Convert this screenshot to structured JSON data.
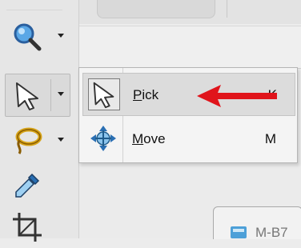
{
  "toolbar": {
    "tools": [
      {
        "name": "zoom-tool",
        "icon": "magnifier-icon"
      },
      {
        "name": "pick-tool",
        "icon": "arrow-cursor-icon"
      },
      {
        "name": "lasso-tool",
        "icon": "lasso-icon"
      },
      {
        "name": "eyedropper-tool",
        "icon": "eyedropper-icon"
      },
      {
        "name": "crop-tool",
        "icon": "crop-icon"
      }
    ]
  },
  "flyout_menu": {
    "items": [
      {
        "label_accel": "P",
        "label_rest": "ick",
        "shortcut": "K",
        "icon": "arrow-cursor-icon"
      },
      {
        "label_accel": "M",
        "label_rest": "ove",
        "shortcut": "M",
        "icon": "move-arrows-icon"
      }
    ]
  },
  "document_tab": {
    "label": "M-B7"
  },
  "annotation": {
    "arrow_color": "#e0141b"
  }
}
